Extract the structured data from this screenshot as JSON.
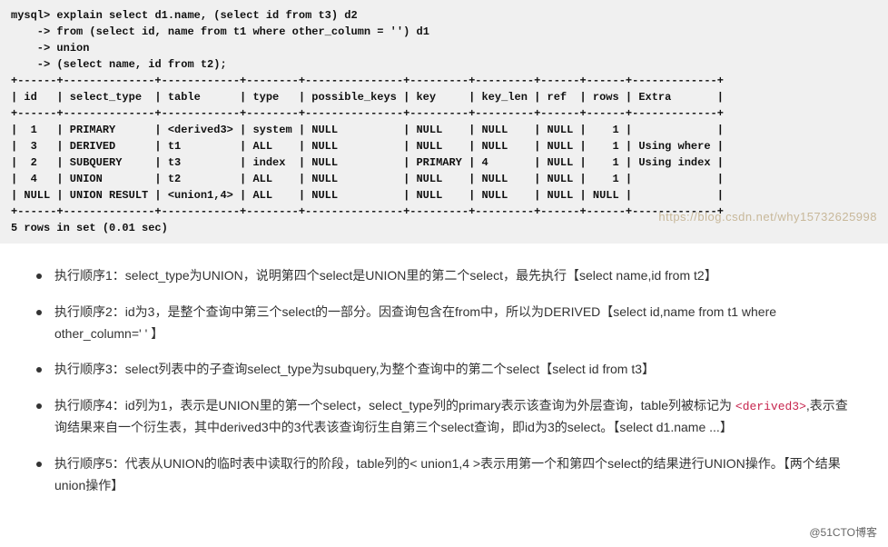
{
  "sql": {
    "prompt": "mysql> ",
    "line1": "explain select d1.name, (select id from t3) d2",
    "cont": "    -> ",
    "line2": "from (select id, name from t1 where other_column = '') d1",
    "line3": "union",
    "line4": "(select name, id from t2);",
    "table_border": "+------+--------------+------------+--------+---------------+---------+---------+------+------+-------------+",
    "header": "| id   | select_type  | table      | type   | possible_keys | key     | key_len | ref  | rows | Extra       |",
    "row1": "|  1   | PRIMARY      | <derived3> | system | NULL          | NULL    | NULL    | NULL |    1 |             |",
    "row2": "|  3   | DERIVED      | t1         | ALL    | NULL          | NULL    | NULL    | NULL |    1 | Using where |",
    "row3": "|  2   | SUBQUERY     | t3         | index  | NULL          | PRIMARY | 4       | NULL |    1 | Using index |",
    "row4": "|  4   | UNION        | t2         | ALL    | NULL          | NULL    | NULL    | NULL |    1 |             |",
    "row5": "| NULL | UNION RESULT | <union1,4> | ALL    | NULL          | NULL    | NULL    | NULL | NULL |             |",
    "footer": "5 rows in set (0.01 sec)",
    "watermark": "https://blog.csdn.net/why15732625998"
  },
  "bullets": {
    "b1": "执行顺序1：select_type为UNION，说明第四个select是UNION里的第二个select，最先执行【select name,id from t2】",
    "b2": "执行顺序2：id为3，是整个查询中第三个select的一部分。因查询包含在from中，所以为DERIVED【select id,name from t1 where other_column=' '  】",
    "b3": "执行顺序3：select列表中的子查询select_type为subquery,为整个查询中的第二个select【select id from t3】",
    "b4_pre": "执行顺序4：id列为1，表示是UNION里的第一个select，select_type列的primary表示该查询为外层查询，table列被标记为",
    "b4_code": "<derived3>",
    "b4_post": ",表示查询结果来自一个衍生表，其中derived3中的3代表该查询衍生自第三个select查询，即id为3的select。【select d1.name ...】",
    "b5": "执行顺序5：代表从UNION的临时表中读取行的阶段，table列的< union1,4 >表示用第一个和第四个select的结果进行UNION操作。【两个结果union操作】"
  },
  "footer": "@51CTO博客"
}
